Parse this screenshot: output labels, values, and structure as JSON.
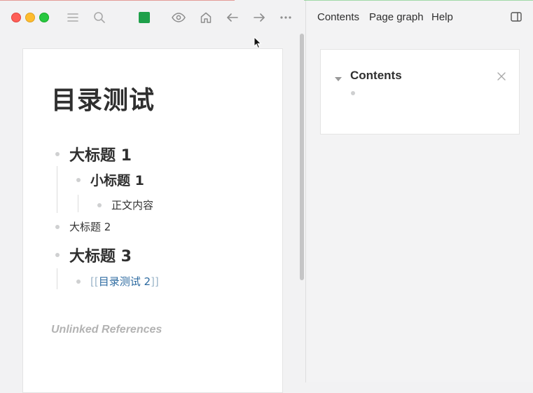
{
  "window": {
    "controls": [
      "close",
      "minimize",
      "zoom"
    ]
  },
  "toolbar": {
    "icons": [
      "menu-icon",
      "search-icon",
      "page-color-icon",
      "eye-icon",
      "home-icon",
      "arrow-left-icon",
      "arrow-right-icon",
      "more-icon"
    ],
    "accent": "#1fa04a"
  },
  "page": {
    "title": "目录测试",
    "blocks": [
      {
        "text": "大标题 1"
      },
      {
        "text": "小标题 1"
      },
      {
        "text": "正文内容"
      },
      {
        "text": "大标题 2"
      },
      {
        "text": "大标题 3"
      },
      {
        "link_open": "[[",
        "link_text": "目录测试 2",
        "link_close": "]]"
      }
    ],
    "unlinked_references": "Unlinked References"
  },
  "right_toolbar": {
    "menu": [
      "Contents",
      "Page graph",
      "Help"
    ],
    "toggle_icon": "sidebar-toggle-icon"
  },
  "contents_panel": {
    "title": "Contents"
  }
}
